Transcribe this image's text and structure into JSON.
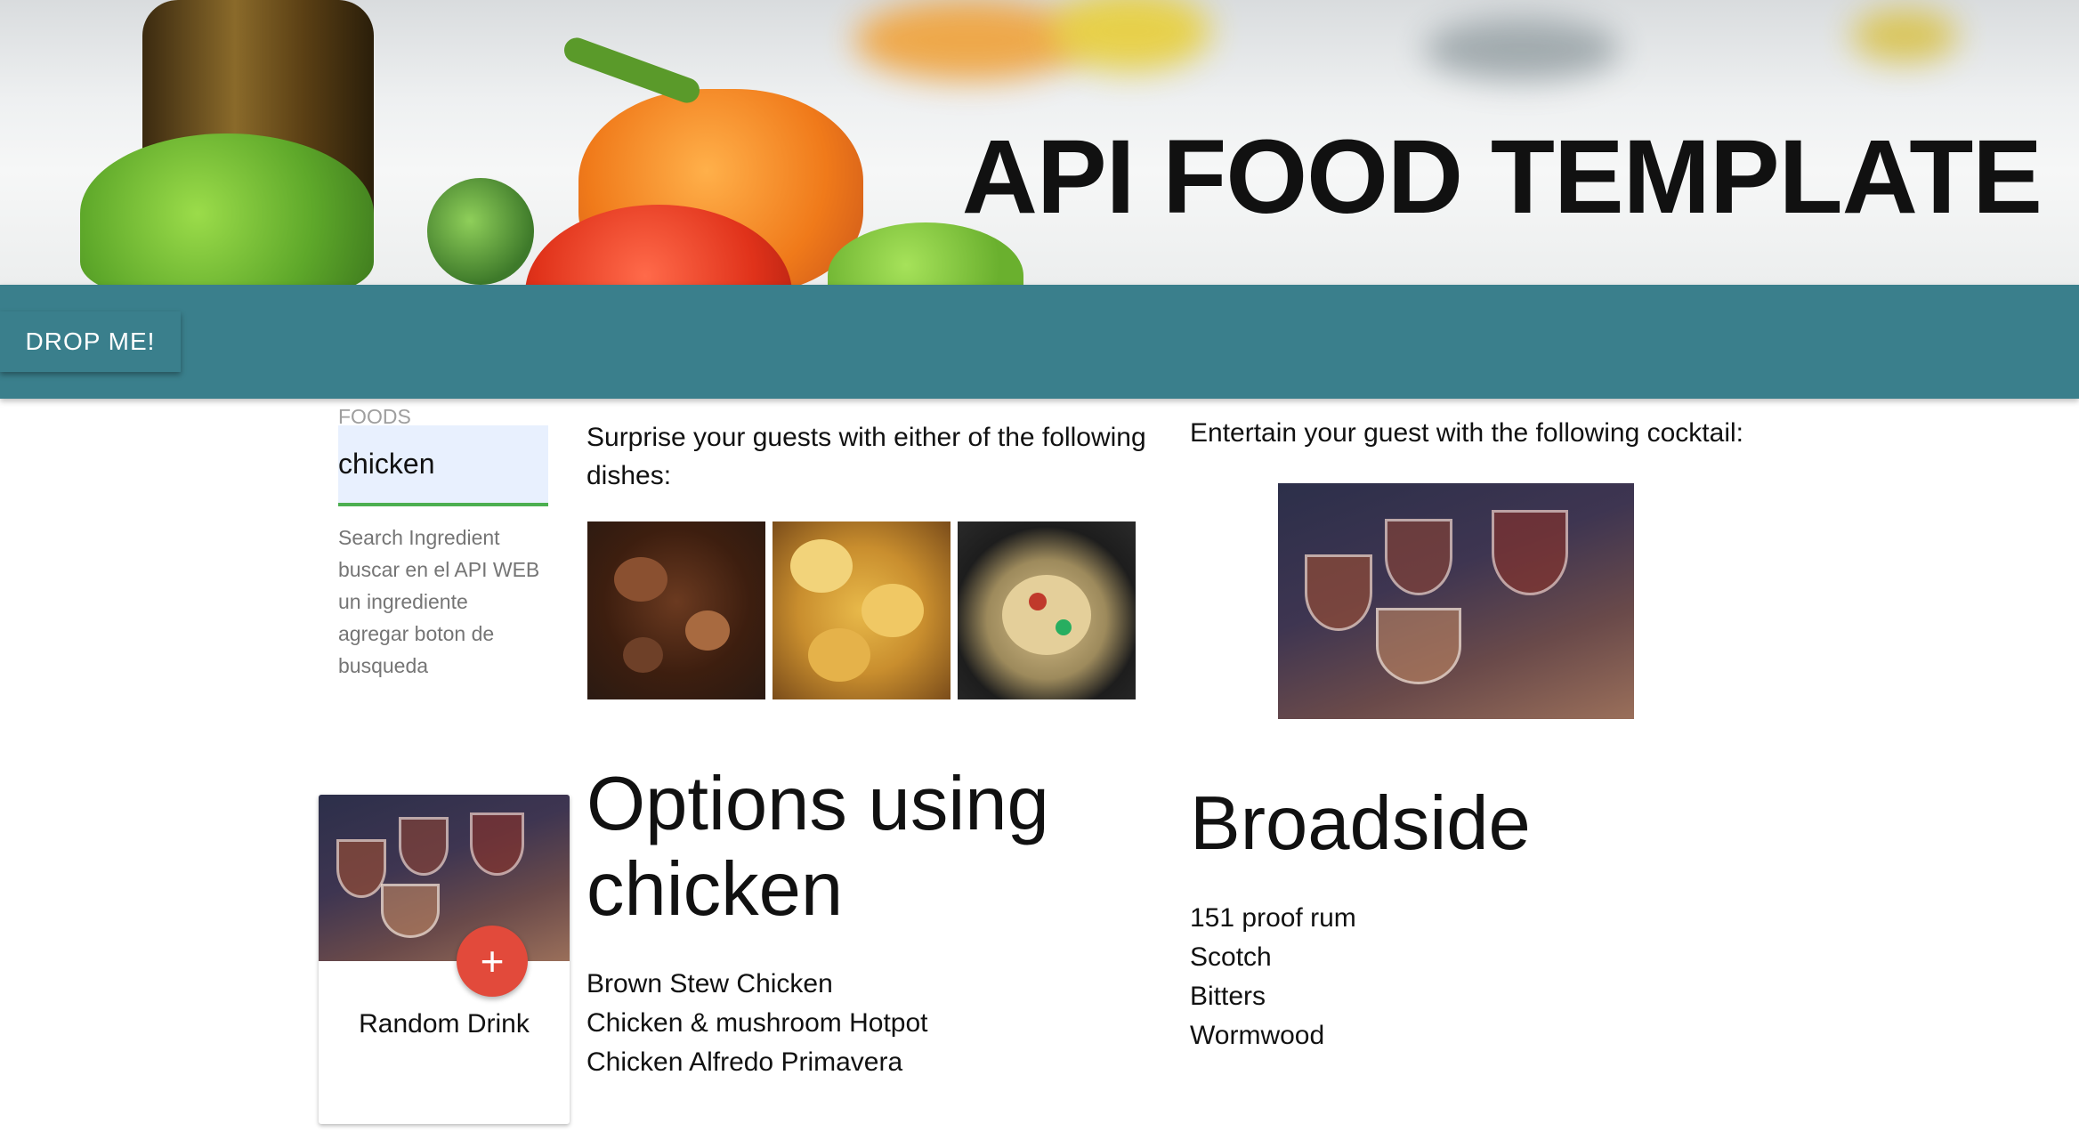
{
  "header": {
    "title": "API FOOD TEMPLATE"
  },
  "nav": {
    "drop_button": "DROP ME!"
  },
  "search": {
    "label": "FOODS",
    "value": "chicken",
    "helper_lines": [
      "Search Ingredient",
      "buscar en el API WEB",
      "un ingrediente",
      "agregar boton de",
      "busqueda"
    ]
  },
  "dishes": {
    "intro": "Surprise your guests with either of the following dishes:",
    "heading": "Options using chicken",
    "items": [
      "Brown Stew Chicken",
      "Chicken & mushroom Hotpot",
      "Chicken Alfredo Primavera"
    ]
  },
  "cocktail": {
    "intro": "Entertain your guest with the following cocktail:",
    "name": "Broadside",
    "ingredients": [
      "151 proof rum",
      "Scotch",
      "Bitters",
      "Wormwood"
    ]
  },
  "card": {
    "title": "Random Drink",
    "add_icon": "plus-icon"
  },
  "colors": {
    "nav_bar": "#3a7f8c",
    "input_underline": "#4caf50",
    "input_bg": "#e8f0fe",
    "fab": "#e24a3b"
  }
}
